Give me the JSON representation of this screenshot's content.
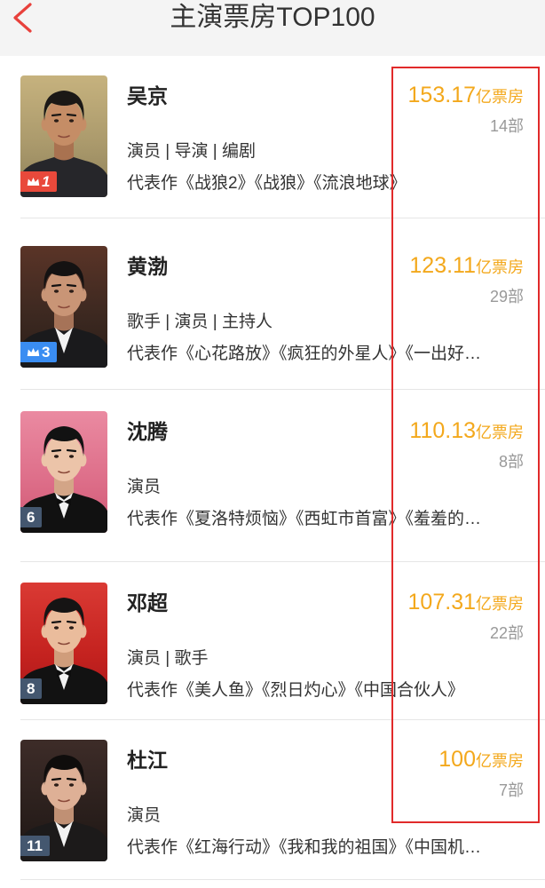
{
  "theme": {
    "header_bg": "#f4f4f4",
    "accent_red": "#e8413c",
    "box_office_color": "#f3a81c",
    "count_color": "#999999",
    "annotation_color": "#e12a2a"
  },
  "header": {
    "back_icon": "chevron-left-icon",
    "title": "主演票房TOP100"
  },
  "actors": [
    {
      "name": "吴京",
      "badge": {
        "label": "1",
        "icon": "crown-icon",
        "color": "#e9493b"
      },
      "roles": "演员 | 导演 | 编剧",
      "works": "代表作《战狼2》《战狼》《流浪地球》",
      "box_office": {
        "value": "153.17",
        "unit": "亿票房"
      },
      "film_count": "14部"
    },
    {
      "name": "黄渤",
      "badge": {
        "label": "3",
        "icon": "crown-icon",
        "color": "#3a8df2"
      },
      "roles": "歌手 | 演员 | 主持人",
      "works": "代表作《心花路放》《疯狂的外星人》《一出好…",
      "box_office": {
        "value": "123.11",
        "unit": "亿票房"
      },
      "film_count": "29部"
    },
    {
      "name": "沈腾",
      "badge": {
        "label": "6",
        "icon": null,
        "color": "#44576f"
      },
      "roles": "演员",
      "works": "代表作《夏洛特烦恼》《西虹市首富》《羞羞的…",
      "box_office": {
        "value": "110.13",
        "unit": "亿票房"
      },
      "film_count": "8部"
    },
    {
      "name": "邓超",
      "badge": {
        "label": "8",
        "icon": null,
        "color": "#44576f"
      },
      "roles": "演员 | 歌手",
      "works": "代表作《美人鱼》《烈日灼心》《中国合伙人》",
      "box_office": {
        "value": "107.31",
        "unit": "亿票房"
      },
      "film_count": "22部"
    },
    {
      "name": "杜江",
      "badge": {
        "label": "11",
        "icon": null,
        "color": "#44576f"
      },
      "roles": "演员",
      "works": "代表作《红海行动》《我和我的祖国》《中国机…",
      "box_office": {
        "value": "100",
        "unit": "亿票房"
      },
      "film_count": "7部"
    }
  ]
}
